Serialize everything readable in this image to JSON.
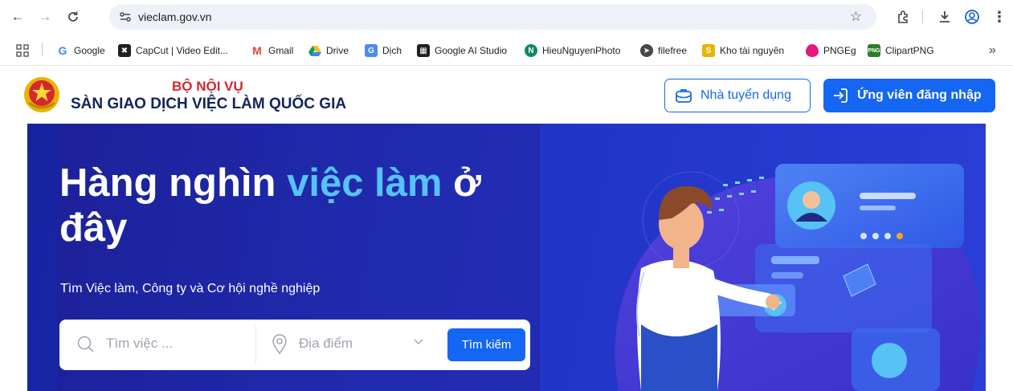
{
  "browser": {
    "url": "vieclam.gov.vn",
    "bookmarks": [
      {
        "label": "Google",
        "icon": "google-icon"
      },
      {
        "label": "CapCut | Video Edit...",
        "icon": "capcut-icon"
      },
      {
        "label": "Gmail",
        "icon": "gmail-icon"
      },
      {
        "label": "Drive",
        "icon": "drive-icon"
      },
      {
        "label": "Dịch",
        "icon": "translate-icon"
      },
      {
        "label": "Google AI Studio",
        "icon": "ai-studio-icon"
      },
      {
        "label": "HieuNguyenPhoto",
        "icon": "photo-icon"
      },
      {
        "label": "filefree",
        "icon": "filefree-icon"
      },
      {
        "label": "Kho tài nguyên",
        "icon": "resources-icon"
      },
      {
        "label": "PNGEg",
        "icon": "pngeg-icon"
      },
      {
        "label": "ClipartPNG",
        "icon": "clipartpng-icon"
      }
    ],
    "overflow_label": "»"
  },
  "header": {
    "ministry": "BỘ NỘI VỤ",
    "site_name": "SÀN GIAO DỊCH VIỆC LÀM QUỐC GIA",
    "employer_button": "Nhà tuyển dụng",
    "login_button": "Ứng viên đăng nhập"
  },
  "hero": {
    "title_part1": "Hàng nghìn ",
    "title_highlight": "việc làm",
    "title_part2": " ở đây",
    "subtitle": "Tìm Việc làm, Công ty và Cơ hội nghề nghiệp",
    "search_placeholder": "Tìm việc ...",
    "location_placeholder": "Địa điểm",
    "search_button": "Tìm kiếm"
  },
  "colors": {
    "primary": "#1566f2",
    "hero_bg": "#1d33c3",
    "highlight": "#56c2f5",
    "ministry_red": "#d8262e",
    "brand_navy": "#10245e"
  }
}
